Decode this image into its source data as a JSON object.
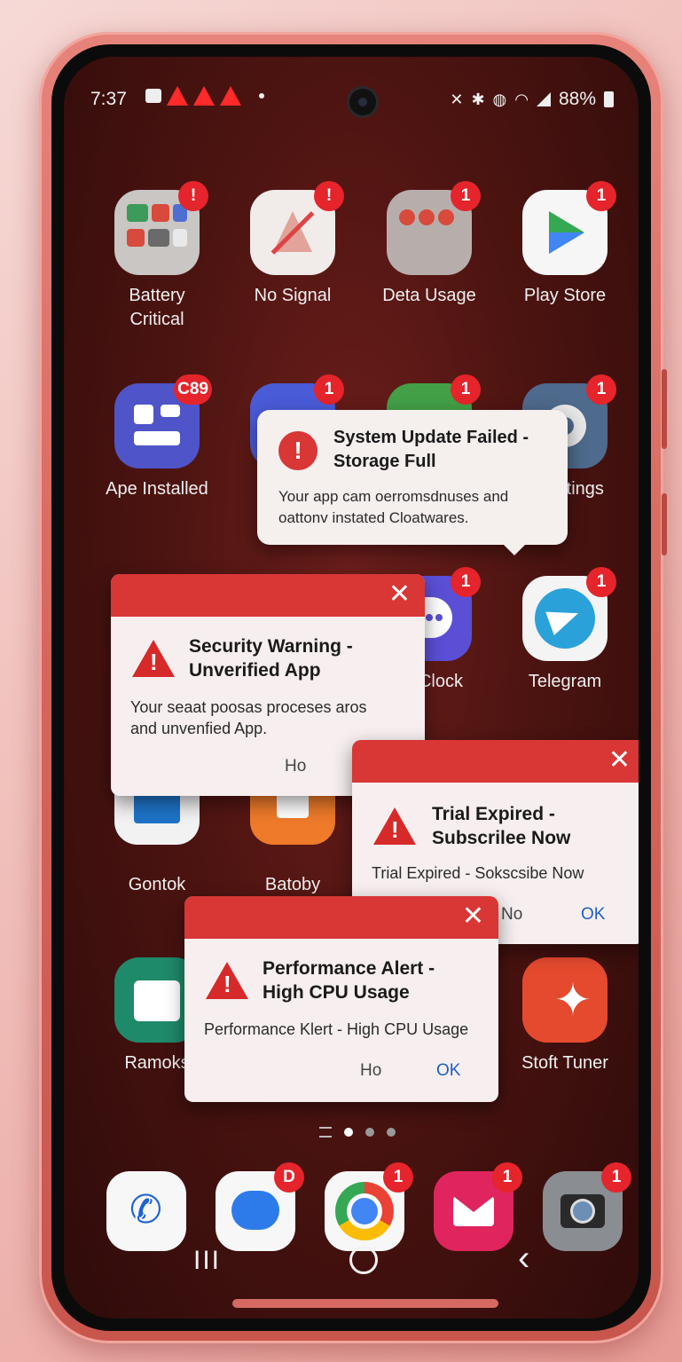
{
  "status_bar": {
    "time": "7:37",
    "battery": "88%"
  },
  "apps": [
    {
      "label": "Battery\nCritical",
      "badge": "!"
    },
    {
      "label": "No Signal",
      "badge": "!"
    },
    {
      "label": "Deta Usage",
      "badge": "1"
    },
    {
      "label": "Play Store",
      "badge": "1"
    },
    {
      "label": "Ape Installed",
      "badge": "C89"
    },
    {
      "label": "",
      "badge": "1"
    },
    {
      "label": "",
      "badge": "1"
    },
    {
      "label": "ttings",
      "badge": "1"
    },
    {
      "label": "Clock",
      "badge": "1"
    },
    {
      "label": "Telegram",
      "badge": "1"
    },
    {
      "label": "Gontok",
      "badge": ""
    },
    {
      "label": "Batoby\nNotificons",
      "badge": ""
    },
    {
      "label": "Ramoks",
      "badge": ""
    },
    {
      "label": "Stoft Tuner",
      "badge": ""
    }
  ],
  "dialogs": {
    "system_update": {
      "title": "System Update Failed -\nStorage Full",
      "body": "Your app cam oerromsdnuses and\noattonv instated Cloatwares."
    },
    "security": {
      "title": "Security Warning -\nUnverified App",
      "body": "Your seaat poosas proceses aros\nand unvenfied App.",
      "no_label": "Ho"
    },
    "trial": {
      "title": "Trial Expired -\nSubscrilee Now",
      "body": "Trial Expired - Sokscsibe Now",
      "no_label": "No",
      "ok_label": "OK"
    },
    "performance": {
      "title": "Performance Alert -\nHigh CPU Usage",
      "body": "Performance Klert - High CPU Usage",
      "no_label": "Ho",
      "ok_label": "OK"
    }
  },
  "dock": [
    {
      "name": "Phone",
      "badge": ""
    },
    {
      "name": "Messages",
      "badge": "D"
    },
    {
      "name": "Chrome",
      "badge": "1"
    },
    {
      "name": "Email",
      "badge": "1"
    },
    {
      "name": "Camera",
      "badge": "1"
    }
  ],
  "colors": {
    "alert_red": "#d93636",
    "badge_red": "#e5242b",
    "ok_blue": "#1f5fbf"
  }
}
